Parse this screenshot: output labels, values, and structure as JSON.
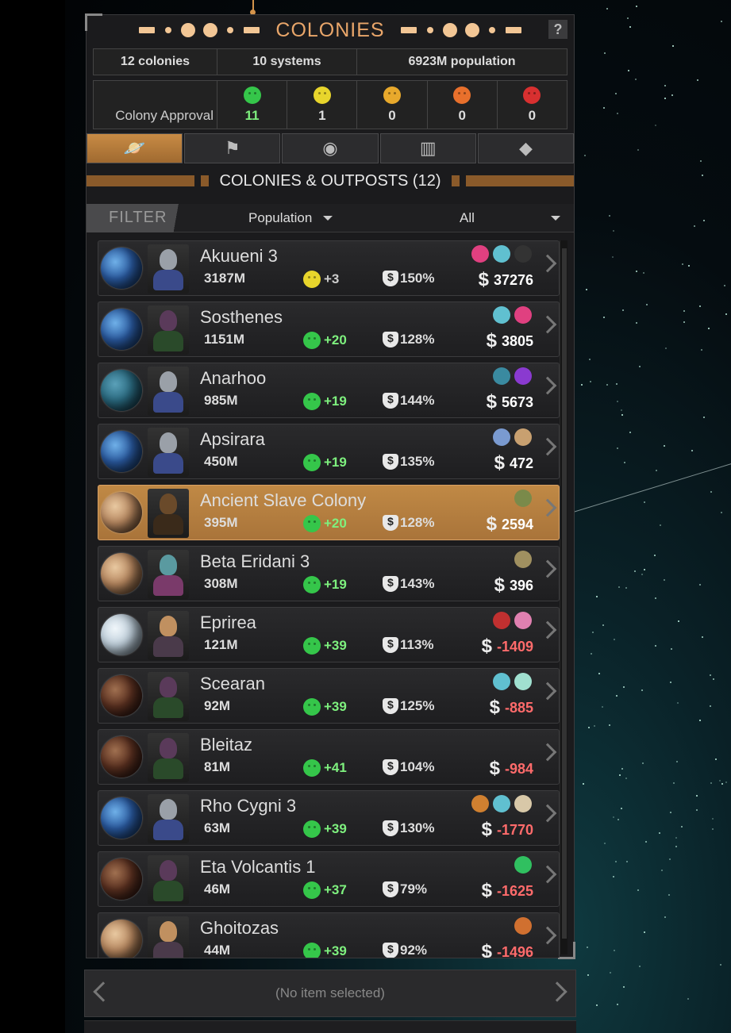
{
  "header": {
    "title": "COLONIES",
    "help_label": "?"
  },
  "stats": {
    "colonies": "12 colonies",
    "systems": "10 systems",
    "population": "6923M population"
  },
  "approval": {
    "label": "Colony Approval",
    "levels": [
      {
        "icon": "ecstatic-face-icon",
        "color": "#35c64a",
        "count": "11",
        "count_color": "#7ef07e"
      },
      {
        "icon": "happy-face-icon",
        "color": "#e8d52c",
        "count": "1",
        "count_color": "#dddddd"
      },
      {
        "icon": "neutral-face-icon",
        "color": "#e8a92c",
        "count": "0",
        "count_color": "#dddddd"
      },
      {
        "icon": "unhappy-face-icon",
        "color": "#e8702c",
        "count": "0",
        "count_color": "#dddddd"
      },
      {
        "icon": "angry-face-icon",
        "color": "#d83030",
        "count": "0",
        "count_color": "#dddddd"
      }
    ]
  },
  "tabs": [
    {
      "name": "tab-colonies",
      "icon": "planet-flag-icon",
      "glyph": "🪐",
      "active": true
    },
    {
      "name": "tab-outposts",
      "icon": "outpost-flag-icon",
      "glyph": "⚑",
      "active": false
    },
    {
      "name": "tab-planets",
      "icon": "planet-icon",
      "glyph": "◉",
      "active": false
    },
    {
      "name": "tab-buildings",
      "icon": "building-icon",
      "glyph": "▥",
      "active": false
    },
    {
      "name": "tab-resources",
      "icon": "diamond-icon",
      "glyph": "◆",
      "active": false
    }
  ],
  "section": {
    "title": "COLONIES & OUTPOSTS (12)"
  },
  "filter": {
    "label": "FILTER",
    "sort": "Population",
    "scope": "All"
  },
  "colors": {
    "positive_money": "#ffffff",
    "negative_money": "#ff6b6b",
    "happy_green": "#35c64a",
    "happy_yellow": "#e8d52c",
    "selected_row": "#b07a3c"
  },
  "colonies": [
    {
      "name": "Akuueni 3",
      "population": "3187M",
      "approval": "+3",
      "mood": "happy",
      "culture": "150%",
      "money": "37276",
      "negative": false,
      "selected": false,
      "planet": "earth",
      "race": "humanoid",
      "resources": [
        "pink-crystal-icon",
        "cyan-orbs-icon",
        "dark-ore-icon"
      ]
    },
    {
      "name": "Sosthenes",
      "population": "1151M",
      "approval": "+20",
      "mood": "ecstatic",
      "culture": "128%",
      "money": "3805",
      "negative": false,
      "selected": false,
      "planet": "earth",
      "race": "insectoid",
      "resources": [
        "cyan-orbs-icon",
        "pink-crystal-icon"
      ]
    },
    {
      "name": "Anarhoo",
      "population": "985M",
      "approval": "+19",
      "mood": "ecstatic",
      "culture": "144%",
      "money": "5673",
      "negative": false,
      "selected": false,
      "planet": "ocean",
      "race": "humanoid",
      "resources": [
        "teal-gem-icon",
        "purple-berries-icon"
      ]
    },
    {
      "name": "Apsirara",
      "population": "450M",
      "approval": "+19",
      "mood": "ecstatic",
      "culture": "135%",
      "money": "472",
      "negative": false,
      "selected": false,
      "planet": "earth",
      "race": "humanoid",
      "resources": [
        "blue-coral-icon",
        "tan-fungus-icon"
      ]
    },
    {
      "name": "Ancient Slave Colony",
      "population": "395M",
      "approval": "+20",
      "mood": "ecstatic",
      "culture": "128%",
      "money": "2594",
      "negative": false,
      "selected": true,
      "planet": "desert",
      "race": "mechanoid",
      "resources": [
        "olive-plant-icon"
      ]
    },
    {
      "name": "Beta Eridani 3",
      "population": "308M",
      "approval": "+19",
      "mood": "ecstatic",
      "culture": "143%",
      "money": "396",
      "negative": false,
      "selected": false,
      "planet": "desert",
      "race": "alien-female",
      "resources": [
        "wheat-icon"
      ]
    },
    {
      "name": "Eprirea",
      "population": "121M",
      "approval": "+39",
      "mood": "ecstatic",
      "culture": "113%",
      "money": "-1409",
      "negative": true,
      "selected": false,
      "planet": "ice",
      "race": "beast",
      "resources": [
        "wine-glass-icon",
        "pink-pearl-icon"
      ]
    },
    {
      "name": "Scearan",
      "population": "92M",
      "approval": "+39",
      "mood": "ecstatic",
      "culture": "125%",
      "money": "-885",
      "negative": true,
      "selected": false,
      "planet": "volcanic",
      "race": "insectoid",
      "resources": [
        "cyan-orbs-icon",
        "crystal-spray-icon"
      ]
    },
    {
      "name": "Bleitaz",
      "population": "81M",
      "approval": "+41",
      "mood": "ecstatic",
      "culture": "104%",
      "money": "-984",
      "negative": true,
      "selected": false,
      "planet": "volcanic",
      "race": "insectoid",
      "resources": []
    },
    {
      "name": "Rho Cygni 3",
      "population": "63M",
      "approval": "+39",
      "mood": "ecstatic",
      "culture": "130%",
      "money": "-1770",
      "negative": true,
      "selected": false,
      "planet": "earth",
      "race": "humanoid",
      "resources": [
        "amber-sacks-icon",
        "cyan-orbs-icon",
        "bone-pile-icon"
      ]
    },
    {
      "name": "Eta Volcantis 1",
      "population": "46M",
      "approval": "+37",
      "mood": "ecstatic",
      "culture": "79%",
      "money": "-1625",
      "negative": true,
      "selected": false,
      "planet": "volcanic",
      "race": "insectoid",
      "resources": [
        "green-gem-icon"
      ]
    },
    {
      "name": "Ghoitozas",
      "population": "44M",
      "approval": "+39",
      "mood": "ecstatic",
      "culture": "92%",
      "money": "-1496",
      "negative": true,
      "selected": false,
      "planet": "desert",
      "race": "beast",
      "resources": [
        "copper-orb-icon"
      ]
    }
  ],
  "footer": {
    "status": "(No item selected)"
  }
}
